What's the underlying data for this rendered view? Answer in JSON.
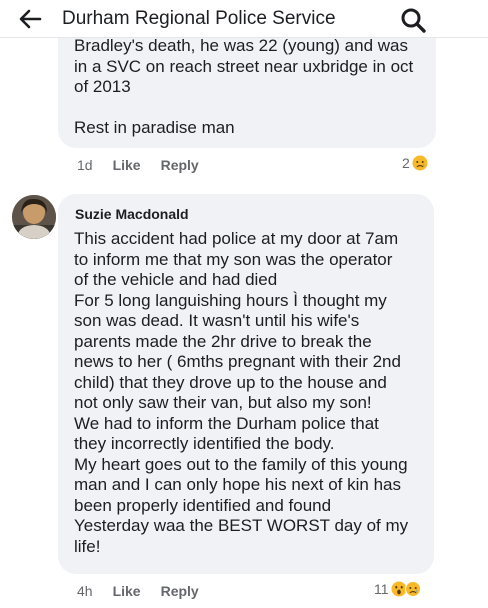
{
  "header": {
    "title": "Durham Regional Police Service"
  },
  "comment1": {
    "text": "Bradley's death, he was 22 (young) and was\nin a SVC on reach street near uxbridge in oct\nof 2013\n\nRest in paradise man",
    "time": "1d",
    "like_label": "Like",
    "reply_label": "Reply",
    "reaction_count": "2"
  },
  "comment2": {
    "author": "Suzie Macdonald",
    "text": "This accident had police at my door at 7am\nto inform me that my son was the operator\nof the vehicle and had died\nFor 5 long languishing hours Ì thought my\nson was dead. It wasn't until his wife's\nparents made the 2hr drive to break the\nnews to her ( 6mths pregnant with their 2nd\nchild) that they drove up to the house and\nnot only saw their van, but also my son!\n We had to inform the Durham police that\nthey incorrectly identified the body.\nMy heart goes out to the family of this young\nman and I can only hope his next of kin has\nbeen properly identified and found\nYesterday waa the BEST WORST day of my\nlife!",
    "time": "4h",
    "like_label": "Like",
    "reply_label": "Reply",
    "reaction_count": "11"
  },
  "icons": {
    "back": "arrow-left-icon",
    "search": "search-icon",
    "sad": "sad-reaction-icon",
    "wow": "wow-reaction-icon"
  },
  "colors": {
    "bubble": "#f0f2f5",
    "meta_text": "#65676b",
    "reaction_yellow": "#f7b928"
  }
}
